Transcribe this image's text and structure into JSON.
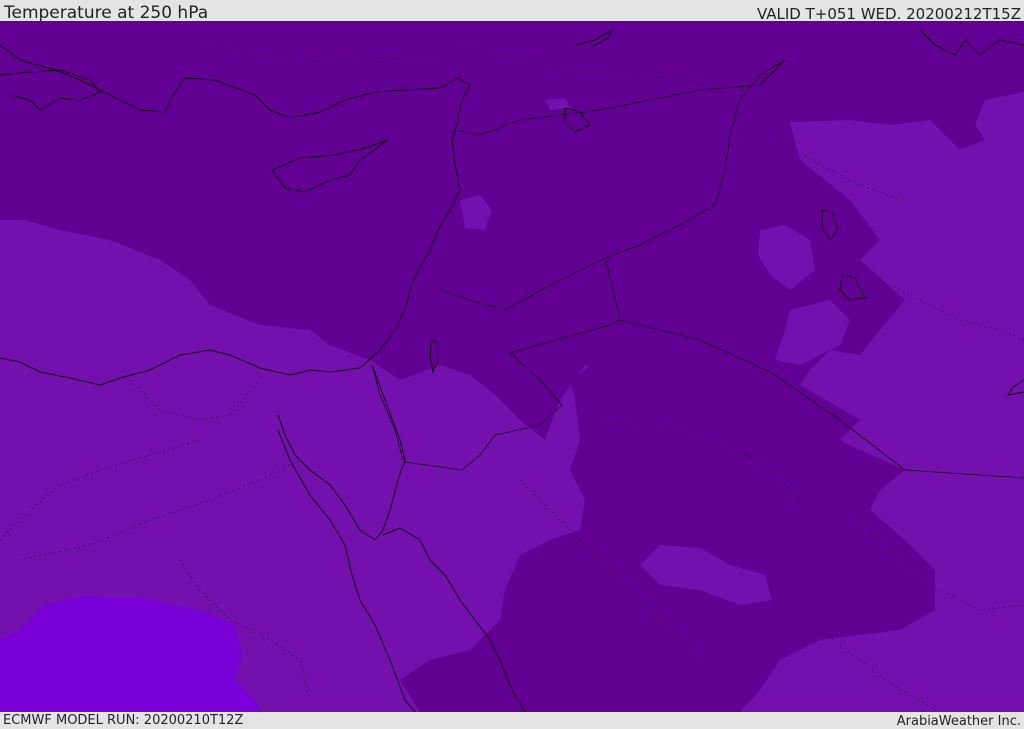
{
  "header": {
    "title": "Temperature at 250 hPa",
    "valid": "VALID T+051 WED. 20200212T15Z"
  },
  "footer": {
    "model_run": "ECMWF MODEL RUN: 20200210T12Z",
    "credit": "ArabiaWeather Inc."
  },
  "map": {
    "field": "Temperature at 250 hPa",
    "colors": {
      "coldest_band": "#630094",
      "middle_band": "#7410ae",
      "warmest_band": "#7a00d8",
      "coastline": "#111111"
    }
  }
}
